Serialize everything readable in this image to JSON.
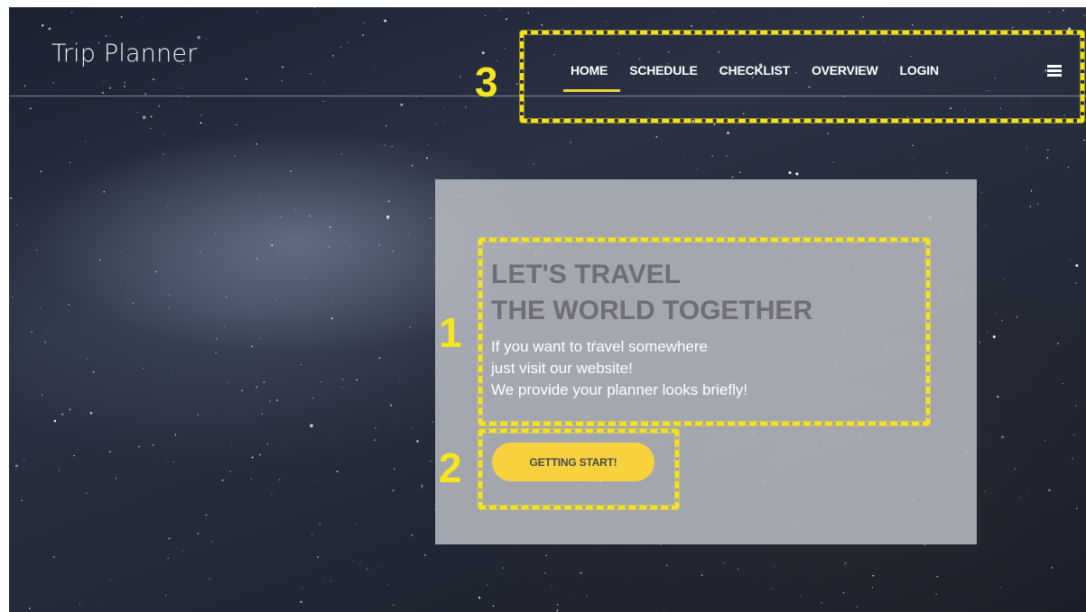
{
  "brand": "Trip Planner",
  "nav": {
    "items": [
      {
        "label": "HOME",
        "active": true
      },
      {
        "label": "SCHEDULE",
        "active": false
      },
      {
        "label": "CHECKLIST",
        "active": false
      },
      {
        "label": "OVERVIEW",
        "active": false
      },
      {
        "label": "LOGIN",
        "active": false
      }
    ],
    "menu_icon": "hamburger-icon"
  },
  "hero": {
    "headline_line1": "LET'S TRAVEL",
    "headline_line2": "THE WORLD TOGETHER",
    "subtext_line1": "If you want to travel somewhere",
    "subtext_line2": "just visit our website!",
    "subtext_line3": "We provide your planner looks briefly!",
    "button_label": "GETTING START!"
  },
  "annotations": [
    {
      "number": "1"
    },
    {
      "number": "2"
    },
    {
      "number": "3"
    }
  ],
  "colors": {
    "accent": "#f7d23e",
    "annotation": "#f5e21c",
    "headline": "#6e6e74"
  }
}
